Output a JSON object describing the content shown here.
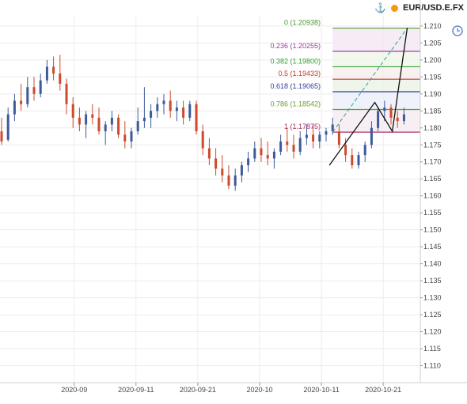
{
  "header": {
    "symbol": "EUR/USD.E.FX",
    "anchor_icon": "anchor-icon",
    "status_icon": "status-dot-icon",
    "status_color": "#f39c12"
  },
  "side_tool": {
    "icon": "clock-icon"
  },
  "chart_data": {
    "type": "candlestick",
    "instrument": "EUR/USD.E.FX",
    "x_axis": {
      "tick_labels": [
        "2020-09",
        "2020-09-11",
        "2020-09-21",
        "2020-10",
        "2020-10-11",
        "2020-10-21"
      ],
      "tick_dates": [
        "2020-09-01",
        "2020-09-11",
        "2020-09-21",
        "2020-10-01",
        "2020-10-11",
        "2020-10-21"
      ],
      "range": [
        "2020-08-20",
        "2020-10-27"
      ]
    },
    "y_axis": {
      "range": [
        1.105,
        1.213
      ],
      "tick_labels": [
        "1.110",
        "1.115",
        "1.120",
        "1.125",
        "1.130",
        "1.135",
        "1.140",
        "1.145",
        "1.150",
        "1.155",
        "1.160",
        "1.165",
        "1.170",
        "1.175",
        "1.180",
        "1.185",
        "1.190",
        "1.195",
        "1.200",
        "1.205",
        "1.210"
      ],
      "position": "right"
    },
    "grid": true,
    "candle_colors": {
      "up": "#3d5a9a",
      "down": "#cd4a2c"
    },
    "candles": [
      {
        "x": 0,
        "o": 1.179,
        "h": 1.183,
        "l": 1.175,
        "c": 1.176
      },
      {
        "x": 1,
        "o": 1.1765,
        "h": 1.186,
        "l": 1.176,
        "c": 1.184
      },
      {
        "x": 2,
        "o": 1.184,
        "h": 1.19,
        "l": 1.182,
        "c": 1.188
      },
      {
        "x": 3,
        "o": 1.188,
        "h": 1.193,
        "l": 1.185,
        "c": 1.187
      },
      {
        "x": 4,
        "o": 1.187,
        "h": 1.195,
        "l": 1.186,
        "c": 1.192
      },
      {
        "x": 5,
        "o": 1.192,
        "h": 1.195,
        "l": 1.188,
        "c": 1.19
      },
      {
        "x": 6,
        "o": 1.19,
        "h": 1.196,
        "l": 1.189,
        "c": 1.194
      },
      {
        "x": 7,
        "o": 1.194,
        "h": 1.2,
        "l": 1.193,
        "c": 1.198
      },
      {
        "x": 8,
        "o": 1.198,
        "h": 1.201,
        "l": 1.194,
        "c": 1.196
      },
      {
        "x": 9,
        "o": 1.196,
        "h": 1.2015,
        "l": 1.191,
        "c": 1.193
      },
      {
        "x": 10,
        "o": 1.193,
        "h": 1.1945,
        "l": 1.184,
        "c": 1.187
      },
      {
        "x": 11,
        "o": 1.187,
        "h": 1.189,
        "l": 1.18,
        "c": 1.183
      },
      {
        "x": 12,
        "o": 1.183,
        "h": 1.186,
        "l": 1.179,
        "c": 1.181
      },
      {
        "x": 13,
        "o": 1.181,
        "h": 1.185,
        "l": 1.177,
        "c": 1.184
      },
      {
        "x": 14,
        "o": 1.184,
        "h": 1.187,
        "l": 1.181,
        "c": 1.183
      },
      {
        "x": 15,
        "o": 1.183,
        "h": 1.186,
        "l": 1.178,
        "c": 1.179
      },
      {
        "x": 16,
        "o": 1.179,
        "h": 1.182,
        "l": 1.175,
        "c": 1.181
      },
      {
        "x": 17,
        "o": 1.181,
        "h": 1.185,
        "l": 1.179,
        "c": 1.183
      },
      {
        "x": 18,
        "o": 1.183,
        "h": 1.184,
        "l": 1.177,
        "c": 1.178
      },
      {
        "x": 19,
        "o": 1.178,
        "h": 1.182,
        "l": 1.174,
        "c": 1.176
      },
      {
        "x": 20,
        "o": 1.176,
        "h": 1.18,
        "l": 1.174,
        "c": 1.179
      },
      {
        "x": 21,
        "o": 1.179,
        "h": 1.186,
        "l": 1.178,
        "c": 1.182
      },
      {
        "x": 22,
        "o": 1.182,
        "h": 1.192,
        "l": 1.18,
        "c": 1.183
      },
      {
        "x": 23,
        "o": 1.183,
        "h": 1.187,
        "l": 1.18,
        "c": 1.185
      },
      {
        "x": 24,
        "o": 1.185,
        "h": 1.189,
        "l": 1.183,
        "c": 1.187
      },
      {
        "x": 25,
        "o": 1.187,
        "h": 1.19,
        "l": 1.184,
        "c": 1.188
      },
      {
        "x": 26,
        "o": 1.188,
        "h": 1.191,
        "l": 1.183,
        "c": 1.185
      },
      {
        "x": 27,
        "o": 1.185,
        "h": 1.188,
        "l": 1.182,
        "c": 1.186
      },
      {
        "x": 28,
        "o": 1.186,
        "h": 1.188,
        "l": 1.181,
        "c": 1.183
      },
      {
        "x": 29,
        "o": 1.183,
        "h": 1.188,
        "l": 1.182,
        "c": 1.187
      },
      {
        "x": 30,
        "o": 1.187,
        "h": 1.188,
        "l": 1.178,
        "c": 1.179
      },
      {
        "x": 31,
        "o": 1.179,
        "h": 1.181,
        "l": 1.172,
        "c": 1.174
      },
      {
        "x": 32,
        "o": 1.174,
        "h": 1.177,
        "l": 1.169,
        "c": 1.171
      },
      {
        "x": 33,
        "o": 1.171,
        "h": 1.174,
        "l": 1.166,
        "c": 1.168
      },
      {
        "x": 34,
        "o": 1.168,
        "h": 1.172,
        "l": 1.164,
        "c": 1.166
      },
      {
        "x": 35,
        "o": 1.166,
        "h": 1.169,
        "l": 1.162,
        "c": 1.163
      },
      {
        "x": 36,
        "o": 1.163,
        "h": 1.168,
        "l": 1.1615,
        "c": 1.166
      },
      {
        "x": 37,
        "o": 1.166,
        "h": 1.17,
        "l": 1.164,
        "c": 1.169
      },
      {
        "x": 38,
        "o": 1.169,
        "h": 1.173,
        "l": 1.167,
        "c": 1.171
      },
      {
        "x": 39,
        "o": 1.171,
        "h": 1.176,
        "l": 1.17,
        "c": 1.174
      },
      {
        "x": 40,
        "o": 1.174,
        "h": 1.177,
        "l": 1.17,
        "c": 1.172
      },
      {
        "x": 41,
        "o": 1.172,
        "h": 1.176,
        "l": 1.169,
        "c": 1.171
      },
      {
        "x": 42,
        "o": 1.171,
        "h": 1.174,
        "l": 1.168,
        "c": 1.173
      },
      {
        "x": 43,
        "o": 1.173,
        "h": 1.178,
        "l": 1.172,
        "c": 1.176
      },
      {
        "x": 44,
        "o": 1.176,
        "h": 1.18,
        "l": 1.173,
        "c": 1.175
      },
      {
        "x": 45,
        "o": 1.175,
        "h": 1.178,
        "l": 1.171,
        "c": 1.173
      },
      {
        "x": 46,
        "o": 1.173,
        "h": 1.179,
        "l": 1.172,
        "c": 1.177
      },
      {
        "x": 47,
        "o": 1.177,
        "h": 1.181,
        "l": 1.175,
        "c": 1.178
      },
      {
        "x": 48,
        "o": 1.178,
        "h": 1.181,
        "l": 1.174,
        "c": 1.176
      },
      {
        "x": 49,
        "o": 1.176,
        "h": 1.179,
        "l": 1.174,
        "c": 1.178
      },
      {
        "x": 50,
        "o": 1.178,
        "h": 1.18,
        "l": 1.176,
        "c": 1.179
      },
      {
        "x": 51,
        "o": 1.179,
        "h": 1.183,
        "l": 1.178,
        "c": 1.181
      },
      {
        "x": 52,
        "o": 1.179,
        "h": 1.181,
        "l": 1.174,
        "c": 1.175
      },
      {
        "x": 53,
        "o": 1.175,
        "h": 1.177,
        "l": 1.17,
        "c": 1.172
      },
      {
        "x": 54,
        "o": 1.172,
        "h": 1.174,
        "l": 1.168,
        "c": 1.169
      },
      {
        "x": 55,
        "o": 1.169,
        "h": 1.173,
        "l": 1.168,
        "c": 1.172
      },
      {
        "x": 56,
        "o": 1.172,
        "h": 1.176,
        "l": 1.17,
        "c": 1.175
      },
      {
        "x": 57,
        "o": 1.175,
        "h": 1.182,
        "l": 1.174,
        "c": 1.18
      },
      {
        "x": 58,
        "o": 1.18,
        "h": 1.186,
        "l": 1.179,
        "c": 1.185
      },
      {
        "x": 59,
        "o": 1.185,
        "h": 1.188,
        "l": 1.182,
        "c": 1.186
      },
      {
        "x": 60,
        "o": 1.186,
        "h": 1.187,
        "l": 1.181,
        "c": 1.183
      },
      {
        "x": 61,
        "o": 1.183,
        "h": 1.185,
        "l": 1.18,
        "c": 1.182
      },
      {
        "x": 62,
        "o": 1.182,
        "h": 1.186,
        "l": 1.181,
        "c": 1.184
      }
    ],
    "fibonacci": {
      "levels": [
        {
          "ratio_label": "0",
          "value_label": "1.20938",
          "price": 1.20938,
          "color": "#4a9a2a"
        },
        {
          "ratio_label": "0.236",
          "value_label": "1.20255",
          "price": 1.20255,
          "color": "#a03aa0"
        },
        {
          "ratio_label": "0.382",
          "value_label": "1.19800",
          "price": 1.198,
          "color": "#3aa03a"
        },
        {
          "ratio_label": "0.5",
          "value_label": "1.19433",
          "price": 1.19433,
          "color": "#c0392b"
        },
        {
          "ratio_label": "0.618",
          "value_label": "1.19065",
          "price": 1.19065,
          "color": "#2c3e9a"
        },
        {
          "ratio_label": "0.786",
          "value_label": "1.18542",
          "price": 1.18542,
          "color": "#6aa02a"
        },
        {
          "ratio_label": "1",
          "value_label": "1.17875",
          "price": 1.17875,
          "color": "#b0306a"
        }
      ],
      "trend_line": {
        "from": {
          "x": 51,
          "y": 1.17875
        },
        "to": {
          "x": 62.5,
          "y": 1.20938
        }
      },
      "band_colors": [
        "#f3e6f3",
        "#eef6e6",
        "#f6ecea",
        "#eaf2e4",
        "#eaeefa",
        "#f4eaf0"
      ]
    },
    "pattern_lines": [
      {
        "x": 50.5,
        "y": 1.169
      },
      {
        "x": 57.5,
        "y": 1.1875
      },
      {
        "x": 60.2,
        "y": 1.179
      },
      {
        "x": 62.5,
        "y": 1.2094
      }
    ]
  }
}
